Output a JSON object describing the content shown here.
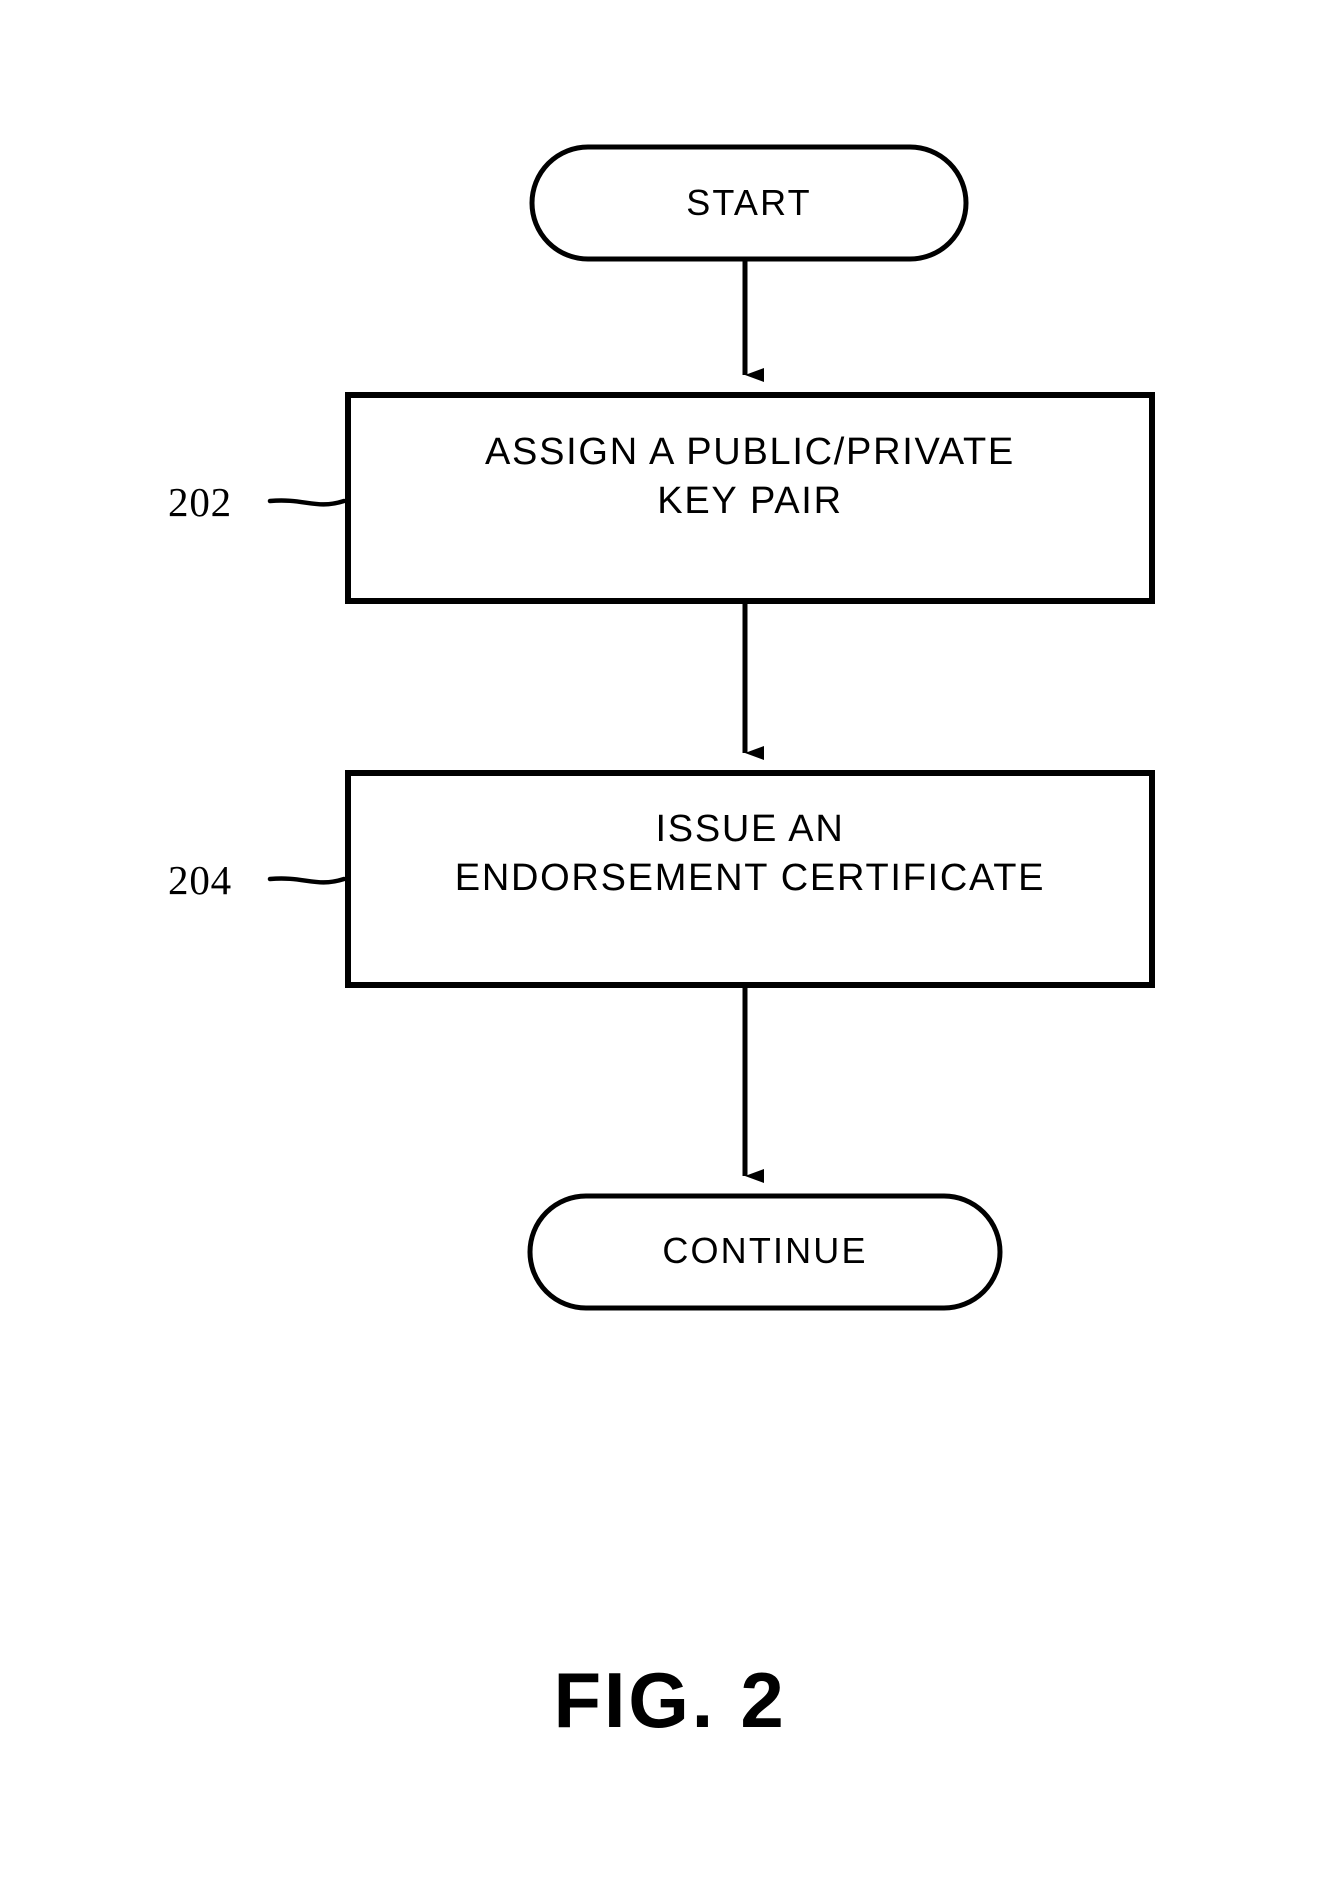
{
  "figure": {
    "caption": "FIG. 2",
    "background_color": "#ffffff",
    "stroke_color": "#000000",
    "nodes": {
      "start": {
        "shape": "terminator",
        "label": "START"
      },
      "step_202": {
        "shape": "process",
        "reference_number": "202",
        "label": "ASSIGN A PUBLIC/PRIVATE\nKEY PAIR"
      },
      "step_204": {
        "shape": "process",
        "reference_number": "204",
        "label": "ISSUE AN\nENDORSEMENT CERTIFICATE"
      },
      "continue": {
        "shape": "terminator",
        "label": "CONTINUE"
      }
    },
    "connectors": [
      {
        "from": "start",
        "to": "step_202",
        "arrowhead": true
      },
      {
        "from": "step_202",
        "to": "step_204",
        "arrowhead": true
      },
      {
        "from": "step_204",
        "to": "continue",
        "arrowhead": true
      }
    ],
    "leader_lines": [
      {
        "reference_number": "202",
        "points_to": "step_202"
      },
      {
        "reference_number": "204",
        "points_to": "step_204"
      }
    ]
  }
}
